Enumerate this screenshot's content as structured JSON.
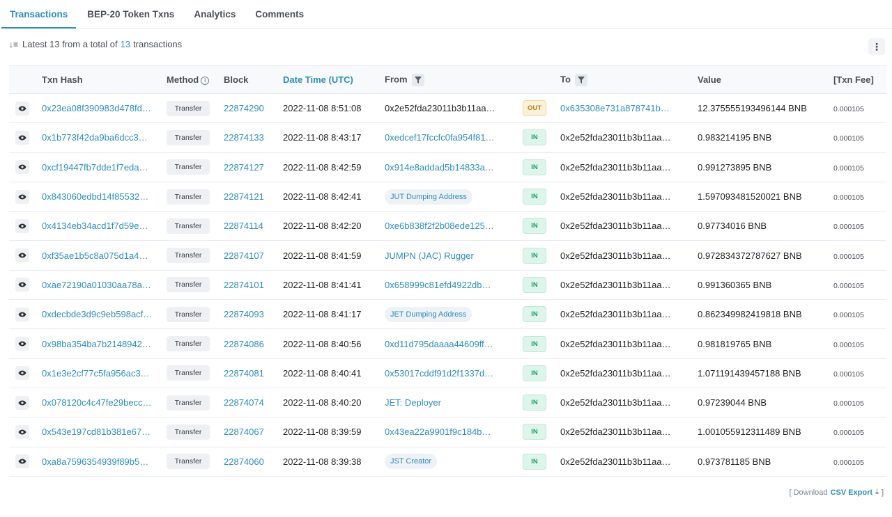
{
  "tabs": [
    {
      "label": "Transactions",
      "active": true
    },
    {
      "label": "BEP-20 Token Txns",
      "active": false
    },
    {
      "label": "Analytics",
      "active": false
    },
    {
      "label": "Comments",
      "active": false
    }
  ],
  "summary": {
    "prefix": "Latest 13 from a total of",
    "count": "13",
    "suffix": "transactions"
  },
  "more_label": "⋮",
  "headers": {
    "hash": "Txn Hash",
    "method": "Method",
    "block": "Block",
    "datetime": "Date Time (UTC)",
    "from": "From",
    "to": "To",
    "value": "Value",
    "fee": "[Txn Fee]"
  },
  "rows": [
    {
      "hash": "0x23ea08f390983d478fd…",
      "method": "Transfer",
      "block": "22874290",
      "time": "2022-11-08 8:51:08",
      "from": "0x2e52fda23011b3b11aa…",
      "from_type": "plain",
      "dir": "OUT",
      "to": "0x635308e731a878741b…",
      "to_type": "link",
      "value": "12.375555193496144 BNB",
      "fee": "0.000105"
    },
    {
      "hash": "0x1b773f42da9ba6dcc3…",
      "method": "Transfer",
      "block": "22874133",
      "time": "2022-11-08 8:43:17",
      "from": "0xedcef17fccfc0fa954f81…",
      "from_type": "link",
      "dir": "IN",
      "to": "0x2e52fda23011b3b11aa…",
      "to_type": "plain",
      "value": "0.983214195 BNB",
      "fee": "0.000105"
    },
    {
      "hash": "0xcf19447fb7dde1f7eda…",
      "method": "Transfer",
      "block": "22874127",
      "time": "2022-11-08 8:42:59",
      "from": "0x914e8addad5b14833a…",
      "from_type": "link",
      "dir": "IN",
      "to": "0x2e52fda23011b3b11aa…",
      "to_type": "plain",
      "value": "0.991273895 BNB",
      "fee": "0.000105"
    },
    {
      "hash": "0x843060edbd14f85532…",
      "method": "Transfer",
      "block": "22874121",
      "time": "2022-11-08 8:42:41",
      "from": "JUT Dumping Address",
      "from_type": "tag",
      "dir": "IN",
      "to": "0x2e52fda23011b3b11aa…",
      "to_type": "plain",
      "value": "1.597093481520021 BNB",
      "fee": "0.000105"
    },
    {
      "hash": "0x4134eb34acd1f7d59e…",
      "method": "Transfer",
      "block": "22874114",
      "time": "2022-11-08 8:42:20",
      "from": "0xe6b838f2f2b08ede125…",
      "from_type": "link",
      "dir": "IN",
      "to": "0x2e52fda23011b3b11aa…",
      "to_type": "plain",
      "value": "0.97734016 BNB",
      "fee": "0.000105"
    },
    {
      "hash": "0xf35ae1b5c8a075d1a4…",
      "method": "Transfer",
      "block": "22874107",
      "time": "2022-11-08 8:41:59",
      "from": "JUMPN (JAC) Rugger",
      "from_type": "link",
      "dir": "IN",
      "to": "0x2e52fda23011b3b11aa…",
      "to_type": "plain",
      "value": "0.972834372787627 BNB",
      "fee": "0.000105"
    },
    {
      "hash": "0xae72190a01030aa78a…",
      "method": "Transfer",
      "block": "22874101",
      "time": "2022-11-08 8:41:41",
      "from": "0x658999c81efd4922db…",
      "from_type": "link",
      "dir": "IN",
      "to": "0x2e52fda23011b3b11aa…",
      "to_type": "plain",
      "value": "0.991360365 BNB",
      "fee": "0.000105"
    },
    {
      "hash": "0xdecbde3d9c9eb598acf…",
      "method": "Transfer",
      "block": "22874093",
      "time": "2022-11-08 8:41:17",
      "from": "JET Dumping Address",
      "from_type": "tag",
      "dir": "IN",
      "to": "0x2e52fda23011b3b11aa…",
      "to_type": "plain",
      "value": "0.862349982419818 BNB",
      "fee": "0.000105"
    },
    {
      "hash": "0x98ba354ba7b2148942…",
      "method": "Transfer",
      "block": "22874086",
      "time": "2022-11-08 8:40:56",
      "from": "0xd11d795daaaa44609ff…",
      "from_type": "link",
      "dir": "IN",
      "to": "0x2e52fda23011b3b11aa…",
      "to_type": "plain",
      "value": "0.981819765 BNB",
      "fee": "0.000105"
    },
    {
      "hash": "0x1e3e2cf77c5fa956ac3…",
      "method": "Transfer",
      "block": "22874081",
      "time": "2022-11-08 8:40:41",
      "from": "0x53017cddf91d2f1337d…",
      "from_type": "link",
      "dir": "IN",
      "to": "0x2e52fda23011b3b11aa…",
      "to_type": "plain",
      "value": "1.071191439457188 BNB",
      "fee": "0.000105"
    },
    {
      "hash": "0x078120c4c47fe29becc…",
      "method": "Transfer",
      "block": "22874074",
      "time": "2022-11-08 8:40:20",
      "from": "JET: Deployer",
      "from_type": "link",
      "dir": "IN",
      "to": "0x2e52fda23011b3b11aa…",
      "to_type": "plain",
      "value": "0.97239044 BNB",
      "fee": "0.000105"
    },
    {
      "hash": "0x543e197cd81b381e67…",
      "method": "Transfer",
      "block": "22874067",
      "time": "2022-11-08 8:39:59",
      "from": "0x43ea22a9901f9c184b…",
      "from_type": "link",
      "dir": "IN",
      "to": "0x2e52fda23011b3b11aa…",
      "to_type": "plain",
      "value": "1.001055912311489 BNB",
      "fee": "0.000105"
    },
    {
      "hash": "0xa8a7596354939f89b5…",
      "method": "Transfer",
      "block": "22874060",
      "time": "2022-11-08 8:39:38",
      "from": "JST Creator",
      "from_type": "tag",
      "dir": "IN",
      "to": "0x2e52fda23011b3b11aa…",
      "to_type": "plain",
      "value": "0.973781185 BNB",
      "fee": "0.000105"
    }
  ],
  "footer": {
    "open": "[ Download",
    "csv": "CSV Export",
    "close": "]"
  },
  "colors": {
    "link": "#2a8fbd",
    "in_badge": "#1f9d6b",
    "out_badge": "#b5811f"
  }
}
